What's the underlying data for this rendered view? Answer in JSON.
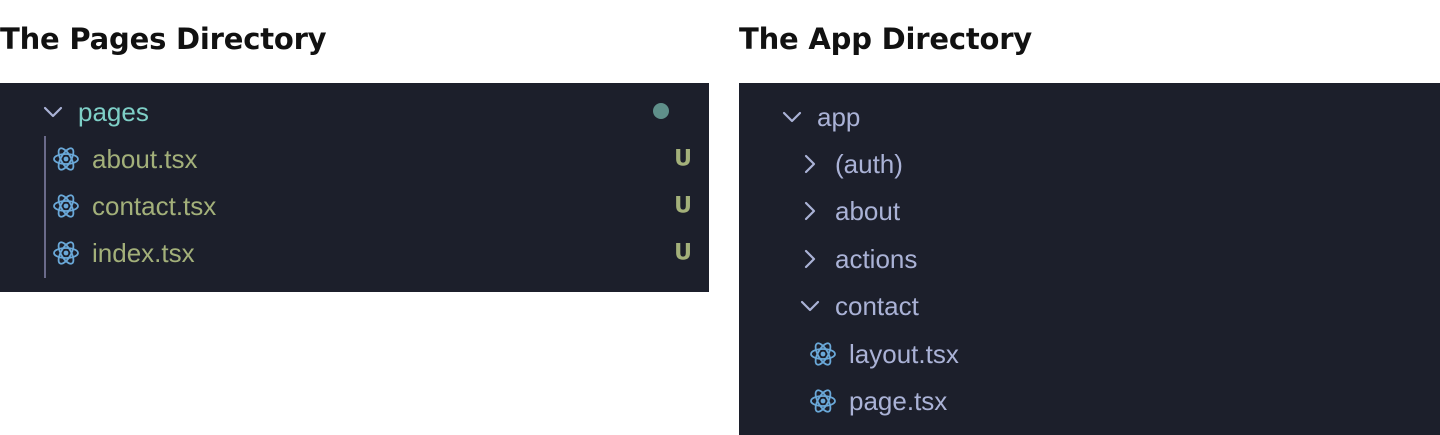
{
  "pages_section": {
    "heading": "The Pages Directory",
    "folder": {
      "name": "pages",
      "expanded": true,
      "modified": true
    },
    "files": [
      {
        "name": "about.tsx",
        "status": "U",
        "icon": "react-icon"
      },
      {
        "name": "contact.tsx",
        "status": "U",
        "icon": "react-icon"
      },
      {
        "name": "index.tsx",
        "status": "U",
        "icon": "react-icon"
      }
    ]
  },
  "app_section": {
    "heading": "The App Directory",
    "root": {
      "name": "app",
      "expanded": true
    },
    "items": [
      {
        "name": "(auth)",
        "type": "folder",
        "expanded": false
      },
      {
        "name": "about",
        "type": "folder",
        "expanded": false
      },
      {
        "name": "actions",
        "type": "folder",
        "expanded": false
      },
      {
        "name": "contact",
        "type": "folder",
        "expanded": true
      },
      {
        "name": "layout.tsx",
        "type": "file",
        "icon": "react-icon"
      },
      {
        "name": "page.tsx",
        "type": "file",
        "icon": "react-icon"
      }
    ]
  },
  "colors": {
    "panel_bg": "#1c1f2b",
    "folder_teal": "#7ecfc7",
    "git_untracked": "#a3b07a",
    "app_text": "#aab2d6",
    "react_icon": "#6aa8d8",
    "modified_dot": "#5f8f8a"
  }
}
